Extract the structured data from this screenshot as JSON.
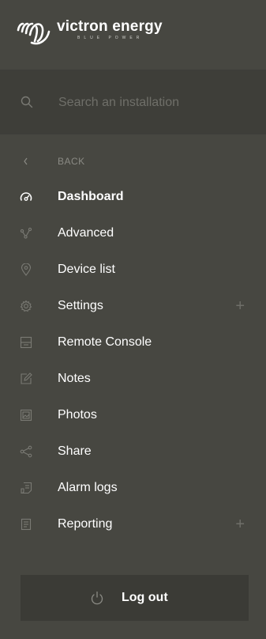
{
  "brand": {
    "name": "victron energy",
    "tagline": "BLUE POWER"
  },
  "search": {
    "placeholder": "Search an installation",
    "icon": "search-icon"
  },
  "nav": {
    "back": {
      "label": "BACK",
      "icon": "chevron-left-icon"
    },
    "items": [
      {
        "label": "Dashboard",
        "icon": "speedometer-icon",
        "active": true
      },
      {
        "label": "Advanced",
        "icon": "graph-nodes-icon"
      },
      {
        "label": "Device list",
        "icon": "location-pin-icon"
      },
      {
        "label": "Settings",
        "icon": "gear-icon",
        "expandable": true,
        "expand_symbol": "+"
      },
      {
        "label": "Remote Console",
        "icon": "console-icon"
      },
      {
        "label": "Notes",
        "icon": "edit-note-icon"
      },
      {
        "label": "Photos",
        "icon": "photo-icon"
      },
      {
        "label": "Share",
        "icon": "share-icon"
      },
      {
        "label": "Alarm logs",
        "icon": "alarm-log-icon"
      },
      {
        "label": "Reporting",
        "icon": "report-icon",
        "expandable": true,
        "expand_symbol": "+"
      }
    ]
  },
  "logout": {
    "label": "Log out",
    "icon": "power-icon"
  },
  "colors": {
    "background": "#474741",
    "search_bg": "#3e3e39",
    "muted": "#6f6f69",
    "text": "#ffffff"
  }
}
